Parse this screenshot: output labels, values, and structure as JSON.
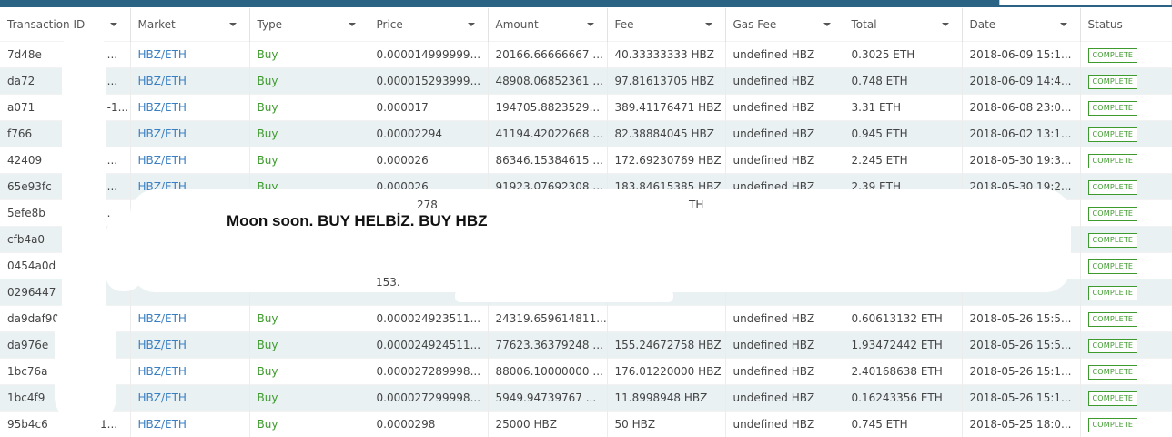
{
  "headers": [
    "Transaction ID",
    "Market",
    "Type",
    "Price",
    "Amount",
    "Fee",
    "Gas Fee",
    "Total",
    "Date",
    "Status"
  ],
  "rows": [
    [
      "7d48e",
      "1...",
      "HBZ/ETH",
      "Buy",
      "0.000014999999...",
      "20166.66666667 ...",
      "40.33333333 HBZ",
      "undefined HBZ",
      "0.3025 ETH",
      "2018-06-09 15:1...",
      "COMPLETE"
    ],
    [
      "da72",
      "1...",
      "HBZ/ETH",
      "Buy",
      "0.000015293999...",
      "48908.06852361 ...",
      "97.81613705 HBZ",
      "undefined HBZ",
      "0.748 ETH",
      "2018-06-09 14:4...",
      "COMPLETE"
    ],
    [
      "a071",
      "6-1...",
      "HBZ/ETH",
      "Buy",
      "0.000017",
      "194705.8823529...",
      "389.41176471 HBZ",
      "undefined HBZ",
      "3.31 ETH",
      "2018-06-08 23:0...",
      "COMPLETE"
    ],
    [
      "f766",
      "",
      "HBZ/ETH",
      "Buy",
      "0.00002294",
      "41194.42022668 ...",
      "82.38884045 HBZ",
      "undefined HBZ",
      "0.945 ETH",
      "2018-06-02 13:1...",
      "COMPLETE"
    ],
    [
      "42409",
      "1...",
      "HBZ/ETH",
      "Buy",
      "0.000026",
      "86346.15384615 ...",
      "172.69230769 HBZ",
      "undefined HBZ",
      "2.245 ETH",
      "2018-05-30 19:3...",
      "COMPLETE"
    ],
    [
      "65e93fc",
      "1...",
      "HBZ/ETH",
      "Buy",
      "0.000026",
      "91923.07692308 ...",
      "183.84615385 HBZ",
      "undefined HBZ",
      "2.39 ETH",
      "2018-05-30 19:2...",
      "COMPLETE"
    ],
    [
      "5efe8b",
      "...",
      "",
      "",
      "",
      "",
      "",
      "",
      "",
      "",
      "COMPLETE"
    ],
    [
      "cfb4a0",
      "..",
      "",
      "",
      "",
      "",
      "",
      "",
      "",
      "",
      "COMPLETE"
    ],
    [
      "0454a0d",
      "..",
      "",
      "",
      "",
      "",
      "",
      "",
      "",
      "",
      "COMPLETE"
    ],
    [
      "0296447",
      "..",
      "",
      "",
      "",
      "",
      "",
      "",
      "",
      "",
      "COMPLETE"
    ],
    [
      "da9daf90",
      "",
      "HBZ/ETH",
      "Buy",
      "0.000024923511...",
      "24319.659614811...",
      "",
      "undefined HBZ",
      "0.60613132 ETH",
      "2018-05-26 15:5...",
      "COMPLETE"
    ],
    [
      "da976e",
      "..",
      "HBZ/ETH",
      "Buy",
      "0.000024924511...",
      "77623.36379248 ...",
      "155.24672758 HBZ",
      "undefined HBZ",
      "1.93472442 ETH",
      "2018-05-26 15:5...",
      "COMPLETE"
    ],
    [
      "1bc76a",
      "...",
      "HBZ/ETH",
      "Buy",
      "0.000027289998...",
      "88006.10000000 ...",
      "176.01220000 HBZ",
      "undefined HBZ",
      "2.40168638 ETH",
      "2018-05-26 15:1...",
      "COMPLETE"
    ],
    [
      "1bc4f9",
      "...",
      "HBZ/ETH",
      "Buy",
      "0.000027299998...",
      "5949.94739767 ...",
      "11.8998948 HBZ",
      "undefined HBZ",
      "0.16243356 ETH",
      "2018-05-26 15:1...",
      "COMPLETE"
    ],
    [
      "95b4c6",
      "1...",
      "HBZ/ETH",
      "Buy",
      "0.0000298",
      "25000 HBZ",
      "50 HBZ",
      "undefined HBZ",
      "0.745 ETH",
      "2018-05-25 18:0...",
      "COMPLETE"
    ]
  ],
  "partial": {
    "price_fragment": "278",
    "fee_fragment": "TH",
    "amount_fragment": "153.",
    "fee_fragment2": "2"
  },
  "annotation": "Moon soon. BUY HELBİZ. BUY HBZ"
}
